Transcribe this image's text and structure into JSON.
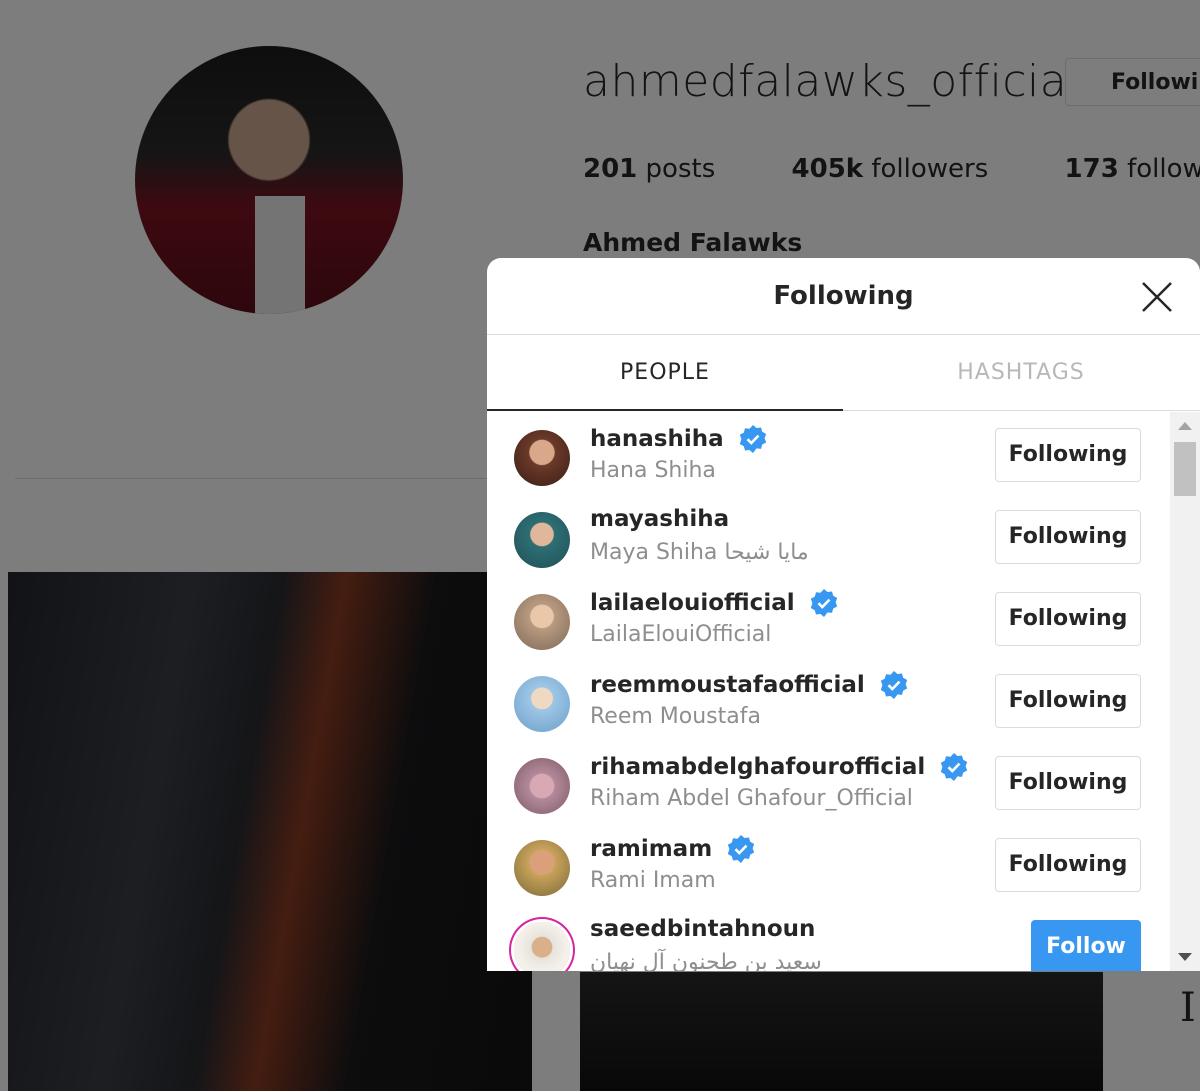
{
  "profile": {
    "username": "ahmedfalawks_official",
    "following_button": "Followin",
    "posts": "201",
    "posts_label": "posts",
    "followers": "405k",
    "followers_label": "followers",
    "following": "173",
    "following_label": "following",
    "full_name": "Ahmed Falawks",
    "side_text": "I"
  },
  "modal": {
    "title": "Following",
    "tabs": [
      {
        "label": "PEOPLE"
      },
      {
        "label": "HASHTAGS"
      }
    ],
    "users": [
      {
        "username": "hanashiha",
        "name": "Hana Shiha",
        "verified": true,
        "button": "Following",
        "avatar_color": "#6b3a2a"
      },
      {
        "username": "mayashiha",
        "name": "Maya Shiha مايا شيحا",
        "verified": false,
        "button": "Following",
        "avatar_color": "#2e6f74"
      },
      {
        "username": "lailaelouiofficial",
        "name": "LailaElouiOfficial",
        "verified": true,
        "button": "Following",
        "avatar_color": "#b89a80"
      },
      {
        "username": "reemmoustafaofficial",
        "name": "Reem Moustafa",
        "verified": true,
        "button": "Following",
        "avatar_color": "#9ec6e6"
      },
      {
        "username": "rihamabdelghafourofficial",
        "name": "Riham Abdel Ghafour_Official",
        "verified": true,
        "button": "Following",
        "avatar_color": "#b48a9a"
      },
      {
        "username": "ramimam",
        "name": "Rami Imam",
        "verified": true,
        "button": "Following",
        "avatar_color": "#c9a25a"
      },
      {
        "username": "saeedbintahnoun",
        "name": "سعيد بن طحنون آل نهيان",
        "verified": false,
        "button": "Follow",
        "avatar_color": "#e7e3dc"
      }
    ]
  },
  "colors": {
    "verified": "#3897f0",
    "follow_button": "#3897f0",
    "secondary_text": "#8e8e8e"
  }
}
